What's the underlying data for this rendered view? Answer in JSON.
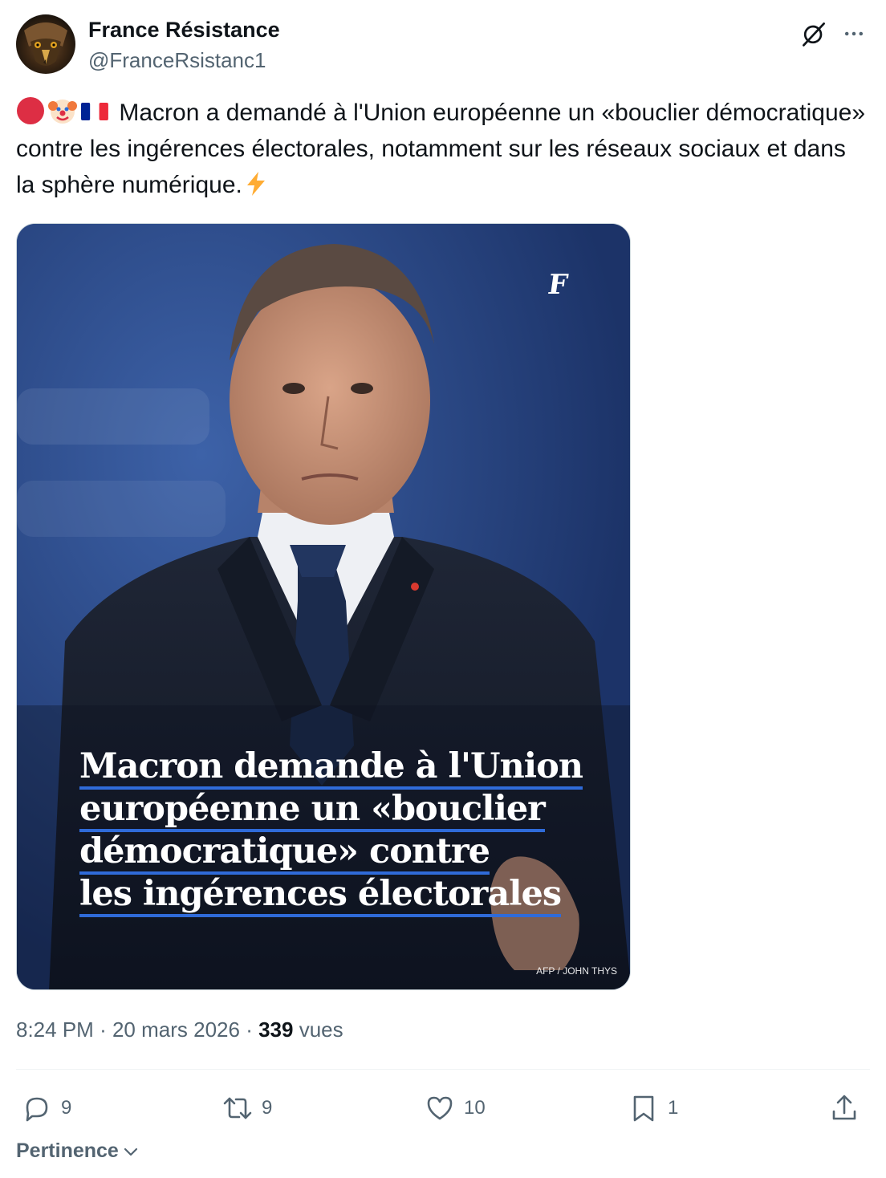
{
  "account": {
    "display_name": "France Résistance",
    "handle": "@FranceRsistanc1",
    "avatar_icon": "eagle-avatar"
  },
  "tweet": {
    "emojis": [
      "red-circle-icon",
      "clown-face-icon",
      "france-flag-icon"
    ],
    "text": "Macron a demandé à l'Union européenne un «bouclier démocratique» contre les ingérences électorales, notamment sur les réseaux sociaux et dans la sphère numérique.",
    "trailing_emoji": "high-voltage-icon"
  },
  "media": {
    "headline_lines": [
      "Macron demande à l'Union",
      "européenne un «bouclier",
      "démocratique» contre",
      "les ingérences électorales"
    ],
    "photo_credit": "AFP / JOHN THYS",
    "logo": "le-figaro-logo"
  },
  "meta": {
    "time": "8:24 PM",
    "date": "20 mars 2026",
    "views_count": "339",
    "views_label": "vues",
    "separator": "·"
  },
  "actions": {
    "replies": "9",
    "reposts": "9",
    "likes": "10",
    "bookmarks": "1"
  },
  "sort": {
    "label": "Pertinence"
  },
  "colors": {
    "text_primary": "#0f1419",
    "text_secondary": "#536471",
    "headline_underline": "#2f6bd9",
    "divider": "#eff3f4"
  }
}
